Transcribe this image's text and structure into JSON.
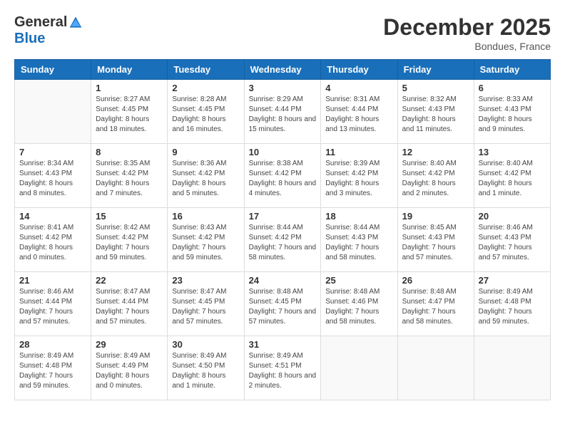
{
  "header": {
    "logo_general": "General",
    "logo_blue": "Blue",
    "month_title": "December 2025",
    "location": "Bondues, France"
  },
  "weekdays": [
    "Sunday",
    "Monday",
    "Tuesday",
    "Wednesday",
    "Thursday",
    "Friday",
    "Saturday"
  ],
  "weeks": [
    [
      {
        "day": "",
        "sunrise": "",
        "sunset": "",
        "daylight": ""
      },
      {
        "day": "1",
        "sunrise": "Sunrise: 8:27 AM",
        "sunset": "Sunset: 4:45 PM",
        "daylight": "Daylight: 8 hours and 18 minutes."
      },
      {
        "day": "2",
        "sunrise": "Sunrise: 8:28 AM",
        "sunset": "Sunset: 4:45 PM",
        "daylight": "Daylight: 8 hours and 16 minutes."
      },
      {
        "day": "3",
        "sunrise": "Sunrise: 8:29 AM",
        "sunset": "Sunset: 4:44 PM",
        "daylight": "Daylight: 8 hours and 15 minutes."
      },
      {
        "day": "4",
        "sunrise": "Sunrise: 8:31 AM",
        "sunset": "Sunset: 4:44 PM",
        "daylight": "Daylight: 8 hours and 13 minutes."
      },
      {
        "day": "5",
        "sunrise": "Sunrise: 8:32 AM",
        "sunset": "Sunset: 4:43 PM",
        "daylight": "Daylight: 8 hours and 11 minutes."
      },
      {
        "day": "6",
        "sunrise": "Sunrise: 8:33 AM",
        "sunset": "Sunset: 4:43 PM",
        "daylight": "Daylight: 8 hours and 9 minutes."
      }
    ],
    [
      {
        "day": "7",
        "sunrise": "Sunrise: 8:34 AM",
        "sunset": "Sunset: 4:43 PM",
        "daylight": "Daylight: 8 hours and 8 minutes."
      },
      {
        "day": "8",
        "sunrise": "Sunrise: 8:35 AM",
        "sunset": "Sunset: 4:42 PM",
        "daylight": "Daylight: 8 hours and 7 minutes."
      },
      {
        "day": "9",
        "sunrise": "Sunrise: 8:36 AM",
        "sunset": "Sunset: 4:42 PM",
        "daylight": "Daylight: 8 hours and 5 minutes."
      },
      {
        "day": "10",
        "sunrise": "Sunrise: 8:38 AM",
        "sunset": "Sunset: 4:42 PM",
        "daylight": "Daylight: 8 hours and 4 minutes."
      },
      {
        "day": "11",
        "sunrise": "Sunrise: 8:39 AM",
        "sunset": "Sunset: 4:42 PM",
        "daylight": "Daylight: 8 hours and 3 minutes."
      },
      {
        "day": "12",
        "sunrise": "Sunrise: 8:40 AM",
        "sunset": "Sunset: 4:42 PM",
        "daylight": "Daylight: 8 hours and 2 minutes."
      },
      {
        "day": "13",
        "sunrise": "Sunrise: 8:40 AM",
        "sunset": "Sunset: 4:42 PM",
        "daylight": "Daylight: 8 hours and 1 minute."
      }
    ],
    [
      {
        "day": "14",
        "sunrise": "Sunrise: 8:41 AM",
        "sunset": "Sunset: 4:42 PM",
        "daylight": "Daylight: 8 hours and 0 minutes."
      },
      {
        "day": "15",
        "sunrise": "Sunrise: 8:42 AM",
        "sunset": "Sunset: 4:42 PM",
        "daylight": "Daylight: 7 hours and 59 minutes."
      },
      {
        "day": "16",
        "sunrise": "Sunrise: 8:43 AM",
        "sunset": "Sunset: 4:42 PM",
        "daylight": "Daylight: 7 hours and 59 minutes."
      },
      {
        "day": "17",
        "sunrise": "Sunrise: 8:44 AM",
        "sunset": "Sunset: 4:42 PM",
        "daylight": "Daylight: 7 hours and 58 minutes."
      },
      {
        "day": "18",
        "sunrise": "Sunrise: 8:44 AM",
        "sunset": "Sunset: 4:43 PM",
        "daylight": "Daylight: 7 hours and 58 minutes."
      },
      {
        "day": "19",
        "sunrise": "Sunrise: 8:45 AM",
        "sunset": "Sunset: 4:43 PM",
        "daylight": "Daylight: 7 hours and 57 minutes."
      },
      {
        "day": "20",
        "sunrise": "Sunrise: 8:46 AM",
        "sunset": "Sunset: 4:43 PM",
        "daylight": "Daylight: 7 hours and 57 minutes."
      }
    ],
    [
      {
        "day": "21",
        "sunrise": "Sunrise: 8:46 AM",
        "sunset": "Sunset: 4:44 PM",
        "daylight": "Daylight: 7 hours and 57 minutes."
      },
      {
        "day": "22",
        "sunrise": "Sunrise: 8:47 AM",
        "sunset": "Sunset: 4:44 PM",
        "daylight": "Daylight: 7 hours and 57 minutes."
      },
      {
        "day": "23",
        "sunrise": "Sunrise: 8:47 AM",
        "sunset": "Sunset: 4:45 PM",
        "daylight": "Daylight: 7 hours and 57 minutes."
      },
      {
        "day": "24",
        "sunrise": "Sunrise: 8:48 AM",
        "sunset": "Sunset: 4:45 PM",
        "daylight": "Daylight: 7 hours and 57 minutes."
      },
      {
        "day": "25",
        "sunrise": "Sunrise: 8:48 AM",
        "sunset": "Sunset: 4:46 PM",
        "daylight": "Daylight: 7 hours and 58 minutes."
      },
      {
        "day": "26",
        "sunrise": "Sunrise: 8:48 AM",
        "sunset": "Sunset: 4:47 PM",
        "daylight": "Daylight: 7 hours and 58 minutes."
      },
      {
        "day": "27",
        "sunrise": "Sunrise: 8:49 AM",
        "sunset": "Sunset: 4:48 PM",
        "daylight": "Daylight: 7 hours and 59 minutes."
      }
    ],
    [
      {
        "day": "28",
        "sunrise": "Sunrise: 8:49 AM",
        "sunset": "Sunset: 4:48 PM",
        "daylight": "Daylight: 7 hours and 59 minutes."
      },
      {
        "day": "29",
        "sunrise": "Sunrise: 8:49 AM",
        "sunset": "Sunset: 4:49 PM",
        "daylight": "Daylight: 8 hours and 0 minutes."
      },
      {
        "day": "30",
        "sunrise": "Sunrise: 8:49 AM",
        "sunset": "Sunset: 4:50 PM",
        "daylight": "Daylight: 8 hours and 1 minute."
      },
      {
        "day": "31",
        "sunrise": "Sunrise: 8:49 AM",
        "sunset": "Sunset: 4:51 PM",
        "daylight": "Daylight: 8 hours and 2 minutes."
      },
      {
        "day": "",
        "sunrise": "",
        "sunset": "",
        "daylight": ""
      },
      {
        "day": "",
        "sunrise": "",
        "sunset": "",
        "daylight": ""
      },
      {
        "day": "",
        "sunrise": "",
        "sunset": "",
        "daylight": ""
      }
    ]
  ]
}
